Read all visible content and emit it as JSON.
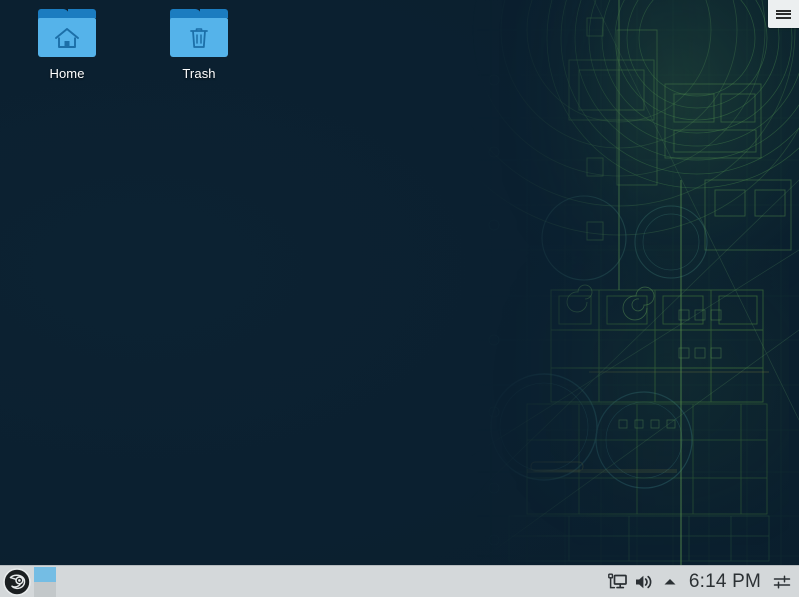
{
  "desktop": {
    "wallpaper_name": "blueprint-wallpaper",
    "background_color": "#0b1f2e",
    "blueprint_accent": "#3f7a4a",
    "icons": [
      {
        "id": "home",
        "label": "Home",
        "icon": "folder-home-icon",
        "folder_tab_color": "#1b7cc0",
        "folder_body_color": "#55b3ea"
      },
      {
        "id": "trash",
        "label": "Trash",
        "icon": "folder-trash-icon",
        "folder_tab_color": "#1b7cc0",
        "folder_body_color": "#55b3ea"
      }
    ]
  },
  "topbar": {
    "menu_button": {
      "name": "hamburger-menu-button",
      "icon": "hamburger-icon",
      "label": "",
      "background": "#eceff0"
    }
  },
  "taskbar": {
    "background": "#d4d8da",
    "launcher": {
      "name": "application-launcher",
      "icon": "opensuse-chameleon-icon",
      "label": ""
    },
    "tasks": [
      {
        "name": "window-button",
        "label": "",
        "active": true,
        "color": "#74bde4"
      }
    ],
    "systray": [
      {
        "id": "network",
        "icon": "network-wired-icon",
        "label": ""
      },
      {
        "id": "volume",
        "icon": "volume-speaker-icon",
        "label": ""
      },
      {
        "id": "expand",
        "icon": "chevron-up-icon",
        "label": ""
      }
    ],
    "clock": {
      "time": "6:14 PM"
    },
    "settings": {
      "id": "settings",
      "icon": "sliders-settings-icon",
      "label": ""
    }
  }
}
